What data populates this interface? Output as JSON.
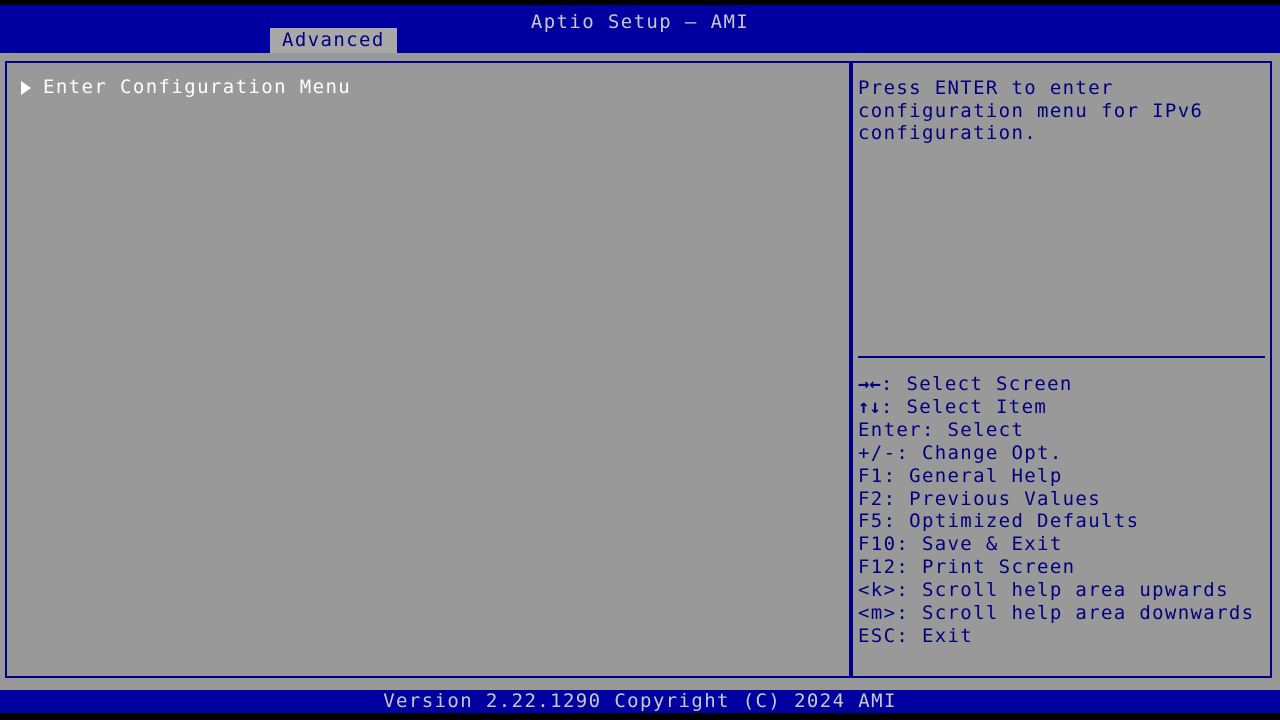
{
  "header": {
    "title": "Aptio Setup – AMI",
    "background_color": "#0000a0",
    "text_color": "#c8c8c8"
  },
  "tabs": [
    {
      "label": "Advanced",
      "active": true
    }
  ],
  "main": {
    "items": [
      {
        "label": "Enter Configuration Menu",
        "bullet": "submenu-triangle",
        "selected": true
      }
    ]
  },
  "help": {
    "lines": [
      "Press ENTER to enter",
      "configuration menu for IPv6",
      "configuration."
    ],
    "text_color": "#00007f"
  },
  "keys": [
    {
      "glyphs": "→←",
      "text": ": Select Screen"
    },
    {
      "glyphs": "↑↓",
      "text": ": Select Item"
    },
    {
      "glyphs": "",
      "text": "Enter: Select"
    },
    {
      "glyphs": "",
      "text": "+/-: Change Opt."
    },
    {
      "glyphs": "",
      "text": "F1: General Help"
    },
    {
      "glyphs": "",
      "text": "F2: Previous Values"
    },
    {
      "glyphs": "",
      "text": "F5: Optimized Defaults"
    },
    {
      "glyphs": "",
      "text": "F10: Save & Exit"
    },
    {
      "glyphs": "",
      "text": "F12: Print Screen"
    },
    {
      "glyphs": "",
      "text": "<k>: Scroll help area upwards"
    },
    {
      "glyphs": "",
      "text": "<m>: Scroll help area downwards"
    },
    {
      "glyphs": "",
      "text": "ESC: Exit"
    }
  ],
  "footer": {
    "version": "Version 2.22.1290 Copyright (C) 2024 AMI"
  },
  "colors": {
    "panel_background": "#999999",
    "panel_border": "#00008b",
    "bar_blue": "#0000a0",
    "accent_text": "#00007f",
    "selected_text": "#ffffff"
  }
}
